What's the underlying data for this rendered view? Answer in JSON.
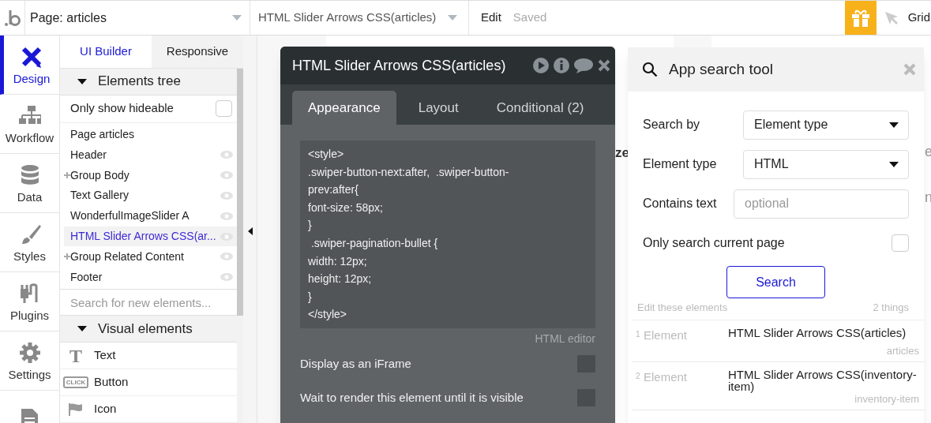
{
  "top_bar": {
    "page_dropdown": "Page: articles",
    "element_dropdown": "HTML Slider Arrows CSS(articles)",
    "edit": "Edit",
    "save_status": "Saved",
    "grid": "Grid"
  },
  "nav": [
    {
      "kind": "design",
      "label": "Design",
      "selected": true
    },
    {
      "kind": "workflow",
      "label": "Workflow",
      "selected": false
    },
    {
      "kind": "data",
      "label": "Data",
      "selected": false
    },
    {
      "kind": "styles",
      "label": "Styles",
      "selected": false
    },
    {
      "kind": "plugins",
      "label": "Plugins",
      "selected": false
    },
    {
      "kind": "settings",
      "label": "Settings",
      "selected": false
    },
    {
      "kind": "document",
      "selected": false
    }
  ],
  "panel_tabs": [
    {
      "label": "UI Builder",
      "selected": true
    },
    {
      "label": "Responsive",
      "selected": false
    }
  ],
  "elements_tree": {
    "title": "Elements tree",
    "expanded": true,
    "filter_label": "Only show hideable",
    "filter_checked": false,
    "items": [
      {
        "label": "Page articles",
        "kind": "page",
        "expandable": false,
        "selected": false
      },
      {
        "label": "Header",
        "kind": "element",
        "expandable": false,
        "selected": false
      },
      {
        "label": "Group Body",
        "kind": "element",
        "expandable": true,
        "selected": false
      },
      {
        "label": "Text Gallery",
        "kind": "element",
        "expandable": false,
        "selected": false
      },
      {
        "label": "WonderfulImageSlider A",
        "kind": "element",
        "expandable": false,
        "selected": false
      },
      {
        "label": "HTML Slider Arrows CSS(ar...",
        "kind": "element",
        "expandable": false,
        "selected": true
      },
      {
        "label": "Group Related Content",
        "kind": "element",
        "expandable": true,
        "selected": false
      },
      {
        "label": "Footer",
        "kind": "element",
        "expandable": false,
        "selected": false
      }
    ]
  },
  "element_search": {
    "placeholder": "Search for new elements..."
  },
  "visual_elements": {
    "title": "Visual elements",
    "expanded": true,
    "items": [
      {
        "label": "Text",
        "kind": "text",
        "icon_text": "T"
      },
      {
        "label": "Button",
        "kind": "button",
        "icon_text": "CLICK"
      },
      {
        "label": "Icon",
        "kind": "flag"
      }
    ]
  },
  "canvas_fragments": [
    "ze",
    "e",
    "n"
  ],
  "property_editor": {
    "title": "HTML Slider Arrows CSS(articles)",
    "tabs": [
      {
        "label": "Appearance",
        "selected": true
      },
      {
        "label": "Layout",
        "selected": false
      },
      {
        "label": "Conditional (2)",
        "selected": false
      }
    ],
    "code_lines": [
      "<style>",
      ".swiper-button-next:after,  .swiper-button-prev:after{",
      "font-size: 58px;",
      "}",
      " .swiper-pagination-bullet {",
      "width: 12px;",
      "height: 12px;",
      "}",
      "</style>"
    ],
    "code_caption": "HTML editor",
    "options": [
      {
        "label": "Display as an iFrame",
        "checked": false
      },
      {
        "label": "Wait to render this element until it is visible",
        "checked": false
      }
    ]
  },
  "search_tool": {
    "title": "App search tool",
    "fields": [
      {
        "kind": "dropdown",
        "label": "Search by",
        "value": "Element type"
      },
      {
        "kind": "dropdown",
        "label": "Element type",
        "value": "HTML"
      },
      {
        "kind": "text",
        "label": "Contains text",
        "placeholder": "optional"
      },
      {
        "kind": "checkbox",
        "label": "Only search current page",
        "checked": false
      }
    ],
    "button": "Search",
    "results_caption": "Edit these elements",
    "results_count": "2 things",
    "results": [
      {
        "index": "1",
        "type": "Element",
        "name": "HTML Slider Arrows CSS(articles)",
        "page": "articles"
      },
      {
        "index": "2",
        "type": "Element",
        "name": "HTML Slider Arrows CSS(inventory-item)",
        "page": "inventory-item"
      }
    ]
  }
}
